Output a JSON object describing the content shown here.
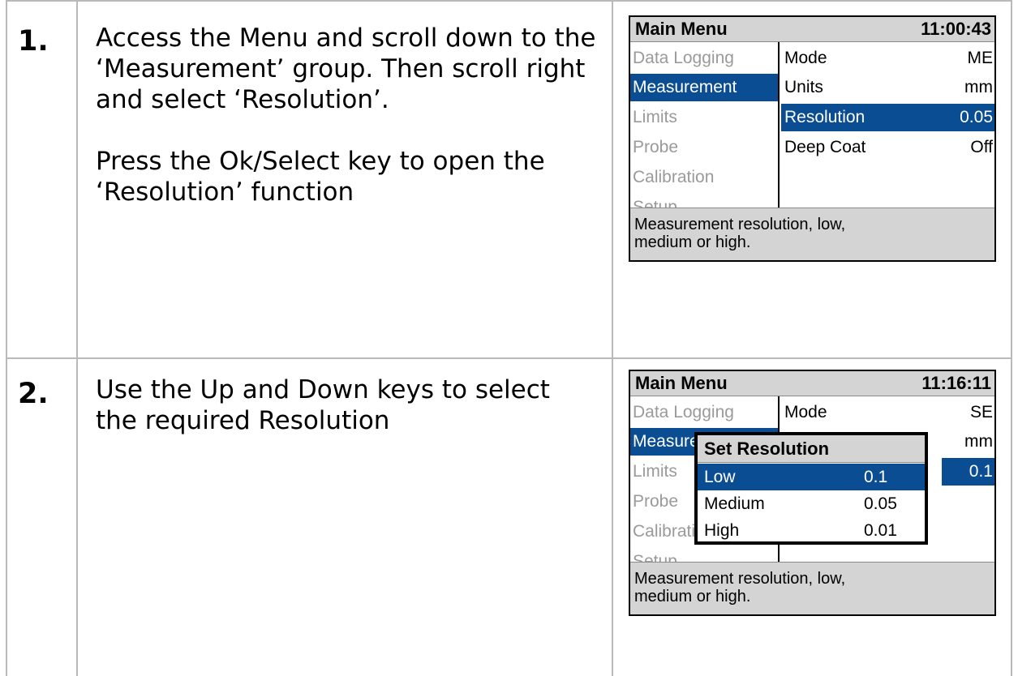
{
  "steps": [
    {
      "number": "1.",
      "paragraphs": [
        "Access the Menu and scroll down to the ‘Measurement’ group. Then scroll right and select ‘Resolution’.",
        "Press the Ok/Select key to open the ‘Resolution’ function"
      ],
      "screen": {
        "title": "Main Menu",
        "clock": "11:00:43",
        "groups": [
          "Data Logging",
          "Measurement",
          "Limits",
          "Probe",
          "Calibration",
          "Setup"
        ],
        "active_group": "Measurement",
        "items": [
          {
            "name": "Mode",
            "value": "ME"
          },
          {
            "name": "Units",
            "value": "mm"
          },
          {
            "name": "Resolution",
            "value": "0.05"
          },
          {
            "name": "Deep Coat",
            "value": "Off"
          }
        ],
        "selected_item": "Resolution",
        "footer": [
          "Measurement resolution, low,",
          "medium or high."
        ]
      }
    },
    {
      "number": "2.",
      "paragraphs": [
        "Use the Up and Down keys to select the required Resolution"
      ],
      "screen": {
        "title": "Main Menu",
        "clock": "11:16:11",
        "groups": [
          "Data Logging",
          "Measurement",
          "Limits",
          "Probe",
          "Calibration",
          "Setup"
        ],
        "active_group": "Measurement",
        "items": [
          {
            "name": "Mode",
            "value": "SE"
          },
          {
            "name": "Units",
            "value": "mm"
          },
          {
            "name": "",
            "value": "0.1"
          }
        ],
        "popup": {
          "title": "Set Resolution",
          "options": [
            {
              "name": "Low",
              "value": "0.1"
            },
            {
              "name": "Medium",
              "value": "0.05"
            },
            {
              "name": "High",
              "value": "0.01"
            }
          ],
          "selected": "Low"
        },
        "footer": [
          "Measurement resolution, low,",
          "medium or high."
        ]
      }
    }
  ],
  "colors": {
    "selection": "#0b4d92",
    "header_grey": "#d4d4d4",
    "inactive_text": "#9a9a9a",
    "grid_line": "#b9b9b9"
  }
}
